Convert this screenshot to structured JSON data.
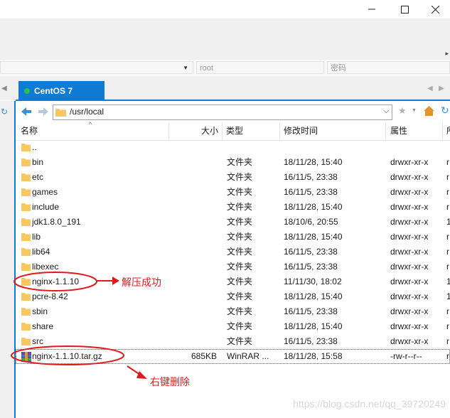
{
  "connection": {
    "host_value": "",
    "user_placeholder": "root",
    "password_placeholder": "密码"
  },
  "tab": {
    "label": "CentOS 7",
    "status_color": "#27c24c"
  },
  "address": {
    "path": "/usr/local"
  },
  "columns": {
    "name": "名称",
    "size": "大小",
    "type": "类型",
    "modified": "修改时间",
    "attrs": "属性",
    "owner": "所"
  },
  "files": [
    {
      "name": "..",
      "size": "",
      "type": "",
      "modified": "",
      "attrs": "",
      "owner": ""
    },
    {
      "name": "bin",
      "size": "",
      "type": "文件夹",
      "modified": "18/11/28, 15:40",
      "attrs": "drwxr-xr-x",
      "owner": "r"
    },
    {
      "name": "etc",
      "size": "",
      "type": "文件夹",
      "modified": "16/11/5, 23:38",
      "attrs": "drwxr-xr-x",
      "owner": "r"
    },
    {
      "name": "games",
      "size": "",
      "type": "文件夹",
      "modified": "16/11/5, 23:38",
      "attrs": "drwxr-xr-x",
      "owner": "r"
    },
    {
      "name": "include",
      "size": "",
      "type": "文件夹",
      "modified": "18/11/28, 15:40",
      "attrs": "drwxr-xr-x",
      "owner": "r"
    },
    {
      "name": "jdk1.8.0_191",
      "size": "",
      "type": "文件夹",
      "modified": "18/10/6, 20:55",
      "attrs": "drwxr-xr-x",
      "owner": "1"
    },
    {
      "name": "lib",
      "size": "",
      "type": "文件夹",
      "modified": "18/11/28, 15:40",
      "attrs": "drwxr-xr-x",
      "owner": "r"
    },
    {
      "name": "lib64",
      "size": "",
      "type": "文件夹",
      "modified": "16/11/5, 23:38",
      "attrs": "drwxr-xr-x",
      "owner": "r"
    },
    {
      "name": "libexec",
      "size": "",
      "type": "文件夹",
      "modified": "16/11/5, 23:38",
      "attrs": "drwxr-xr-x",
      "owner": "r"
    },
    {
      "name": "nginx-1.1.10",
      "size": "",
      "type": "文件夹",
      "modified": "11/11/30, 18:02",
      "attrs": "drwxr-xr-x",
      "owner": "1"
    },
    {
      "name": "pcre-8.42",
      "size": "",
      "type": "文件夹",
      "modified": "18/11/28, 15:40",
      "attrs": "drwxr-xr-x",
      "owner": "1"
    },
    {
      "name": "sbin",
      "size": "",
      "type": "文件夹",
      "modified": "16/11/5, 23:38",
      "attrs": "drwxr-xr-x",
      "owner": "r"
    },
    {
      "name": "share",
      "size": "",
      "type": "文件夹",
      "modified": "18/11/28, 15:40",
      "attrs": "drwxr-xr-x",
      "owner": "r"
    },
    {
      "name": "src",
      "size": "",
      "type": "文件夹",
      "modified": "16/11/5, 23:38",
      "attrs": "drwxr-xr-x",
      "owner": "r"
    },
    {
      "name": "nginx-1.1.10.tar.gz",
      "size": "685KB",
      "type": "WinRAR ...",
      "modified": "18/11/28, 15:58",
      "attrs": "-rw-r--r--",
      "owner": "r"
    }
  ],
  "annotations": {
    "extract_success": "解压成功",
    "right_click_delete": "右键删除"
  },
  "watermark": "https://blog.csdn.net/qq_39720249",
  "colors": {
    "accent": "#0f7bd4",
    "annotation": "#e0191b",
    "folder": "#f6c85f"
  }
}
